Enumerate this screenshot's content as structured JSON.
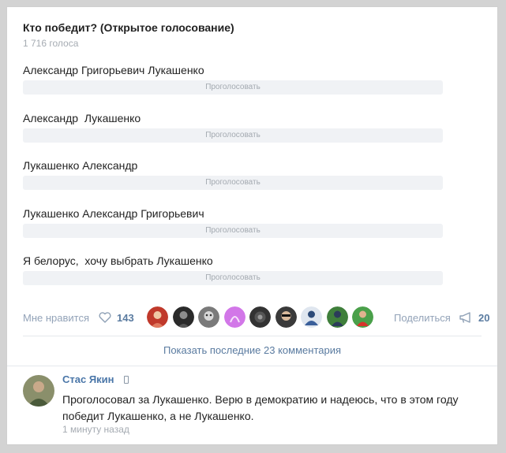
{
  "poll": {
    "title": "Кто победит? (Открытое голосование)",
    "votes": "1 716 голоса",
    "vote_label": "Проголосовать",
    "options": [
      {
        "label": "Александр Григорьевич Лукашенко"
      },
      {
        "label": "Александр  Лукашенко"
      },
      {
        "label": "Лукашенко Александр"
      },
      {
        "label": "Лукашенко Александр Григорьевич"
      },
      {
        "label": "Я белорус,  хочу выбрать Лукашенко"
      }
    ]
  },
  "actions": {
    "like_label": "Мне нравится",
    "like_count": "143",
    "share_label": "Поделиться",
    "share_count": "20",
    "icons": {
      "like": "heart-icon",
      "share": "megaphone-icon"
    }
  },
  "comments": {
    "show_more": "Показать последние 23 комментария",
    "items": [
      {
        "author": "Стас Якин",
        "text": "Проголосовал за Лукашенко. Верю в демократию и надеюсь, что в этом году победит Лукашенко,  а не Лукашенко.",
        "time": "1 минуту назад"
      }
    ]
  },
  "colors": {
    "link": "#4a76a8",
    "muted": "#93a3b8",
    "button_bg": "#f0f2f5"
  }
}
